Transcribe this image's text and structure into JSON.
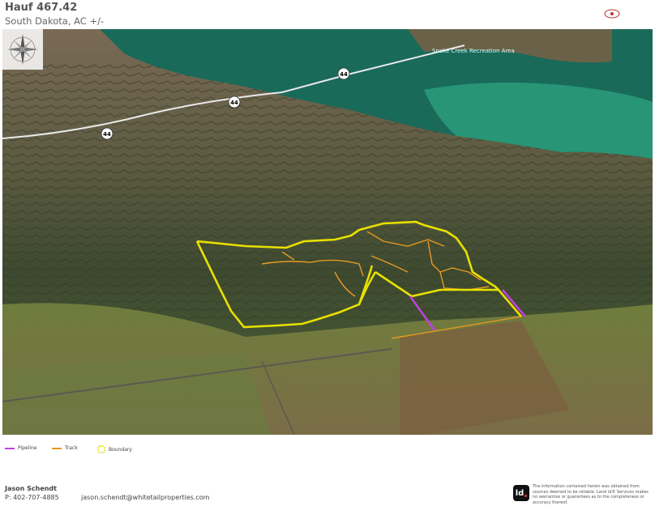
{
  "header": {
    "title": "Hauf 467.42",
    "subtitle": "South Dakota,  AC +/-"
  },
  "map": {
    "labels": {
      "recreation_area": "Snake Creek Recreation Area",
      "highway_shields": [
        "44",
        "44",
        "44"
      ]
    },
    "colors": {
      "boundary": "#e8e000",
      "track": "#e69a22",
      "pipeline": "#c040e0",
      "water": "#1a6a5a",
      "water_light": "#2a9a7a"
    }
  },
  "legend": {
    "items": [
      {
        "label": "Pipeline",
        "color": "#c040e0",
        "icon": "line"
      },
      {
        "label": "Track",
        "color": "#e69a22",
        "icon": "line"
      },
      {
        "label": "Boundary",
        "color": "#e8e000",
        "icon": "dashed-loop"
      }
    ]
  },
  "agent": {
    "name": "Jason Schendt",
    "phone": "P: 402-707-4885",
    "email": "jason.schendt@whitetailproperties.com"
  },
  "disclaimer": {
    "logo_text": "ld",
    "text": "The information contained herein was obtained from sources deemed to be reliable. Land id® Services makes no warranties or guarantees as to the completeness or accuracy thereof."
  }
}
